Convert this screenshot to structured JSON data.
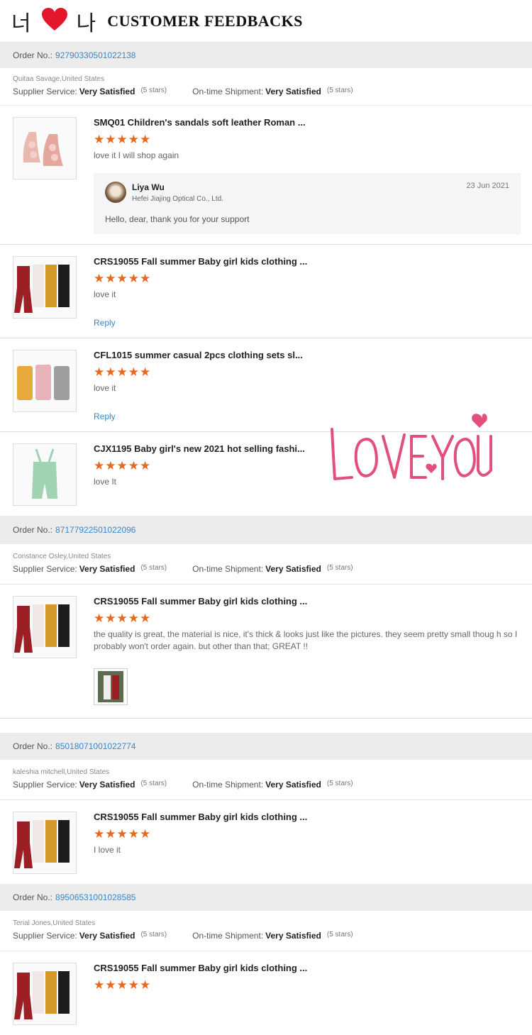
{
  "header": {
    "korean_left": "너",
    "korean_right": "나",
    "title": "CUSTOMER FEEDBACKS",
    "heart_color": "#e4162c"
  },
  "decoration": {
    "text": "LOVE YOU",
    "color": "#e0507a"
  },
  "labels": {
    "order_no": "Order No.:",
    "supplier": "Supplier Service:",
    "shipment": "On-time Shipment:",
    "satisfied": "Very Satisfied",
    "five_stars": "(5 stars)",
    "stars": "★★★★★",
    "reply": "Reply"
  },
  "orders": [
    {
      "order_no": "92790330501022138",
      "buyer": "Quitaa Savage,United States",
      "items": [
        {
          "product": "SMQ01 Children's sandals soft leather Roman ...",
          "comment": "love it I will shop again",
          "seller_reply": {
            "name": "Liya Wu",
            "company": "Hefei Jiajing Optical Co., Ltd.",
            "date": "23 Jun 2021",
            "message": "Hello, dear, thank you for your support"
          }
        },
        {
          "product": "CRS19055 Fall summer Baby girl kids clothing ...",
          "comment": "love it"
        },
        {
          "product": "CFL1015 summer casual 2pcs clothing sets sl...",
          "comment": "love it"
        },
        {
          "product": "CJX1195 Baby girl's new 2021 hot selling fashi...",
          "comment": "love It"
        }
      ]
    },
    {
      "order_no": "87177922501022096",
      "buyer": "Constance Osley,United States",
      "items": [
        {
          "product": "CRS19055 Fall summer Baby girl kids clothing ...",
          "comment": "the quality is great, the material is nice, it's thick & looks just like the pictures. they seem pretty small thoug h so I probably won't order again. but other than that; GREAT !!"
        }
      ]
    },
    {
      "order_no": "85018071001022774",
      "buyer": "kaleshia mitchell,United States",
      "items": [
        {
          "product": "CRS19055 Fall summer Baby girl kids clothing ...",
          "comment": "I love it"
        }
      ]
    },
    {
      "order_no": "89506531001028585",
      "buyer": "Terial Jones,United States",
      "items": [
        {
          "product": "CRS19055 Fall summer Baby girl kids clothing ...",
          "comment": ""
        }
      ]
    }
  ]
}
